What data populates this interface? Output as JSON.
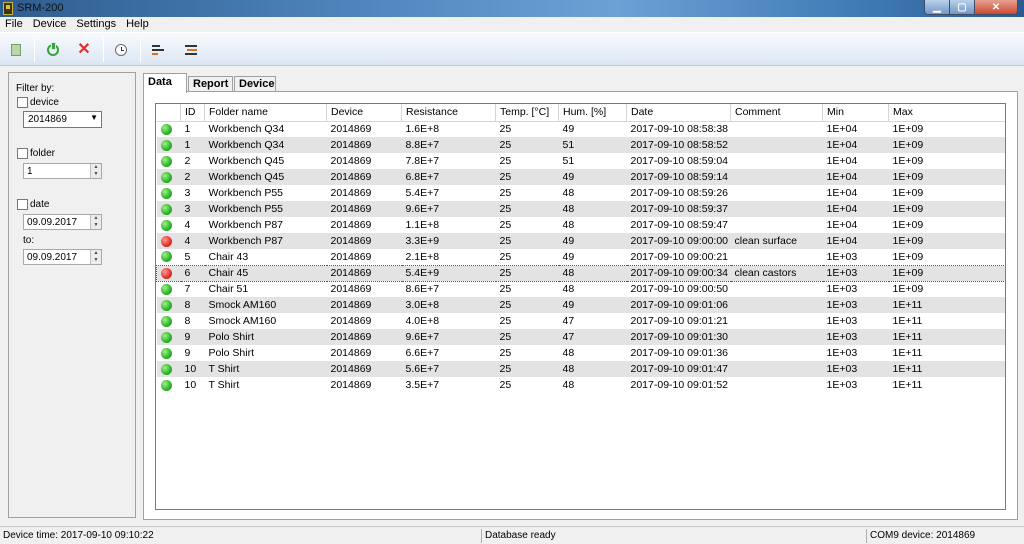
{
  "window": {
    "title": "SRM-200"
  },
  "menu": [
    "File",
    "Device",
    "Settings",
    "Help"
  ],
  "toolbar": {
    "icons": [
      "save-icon",
      "connect-power-icon",
      "disconnect-x-icon",
      "clock-icon",
      "report-bars-icon",
      "export-bars-icon"
    ],
    "disconnect_glyph": "✕"
  },
  "filter": {
    "heading": "Filter by:",
    "device_label": "device",
    "device_value": "2014869",
    "folder_label": "folder",
    "folder_value": "1",
    "date_label": "date",
    "date_from": "09.09.2017",
    "to_label": "to:",
    "date_to": "09.09.2017"
  },
  "tabs": [
    "Data",
    "Report",
    "Device"
  ],
  "table": {
    "columns": [
      "",
      "ID",
      "Folder name",
      "Device",
      "Resistance",
      "Temp. [°C]",
      "Hum. [%]",
      "Date",
      "Comment",
      "Min",
      "Max"
    ],
    "rows": [
      {
        "status": "green",
        "id": "1",
        "folder": "Workbench Q34",
        "device": "2014869",
        "resistance": "1.6E+8",
        "temp": "25",
        "hum": "49",
        "date": "2017-09-10 08:58:38",
        "comment": "",
        "min": "1E+04",
        "max": "1E+09"
      },
      {
        "status": "green",
        "id": "1",
        "folder": "Workbench Q34",
        "device": "2014869",
        "resistance": "8.8E+7",
        "temp": "25",
        "hum": "51",
        "date": "2017-09-10 08:58:52",
        "comment": "",
        "min": "1E+04",
        "max": "1E+09"
      },
      {
        "status": "green",
        "id": "2",
        "folder": "Workbench Q45",
        "device": "2014869",
        "resistance": "7.8E+7",
        "temp": "25",
        "hum": "51",
        "date": "2017-09-10 08:59:04",
        "comment": "",
        "min": "1E+04",
        "max": "1E+09"
      },
      {
        "status": "green",
        "id": "2",
        "folder": "Workbench Q45",
        "device": "2014869",
        "resistance": "6.8E+7",
        "temp": "25",
        "hum": "49",
        "date": "2017-09-10 08:59:14",
        "comment": "",
        "min": "1E+04",
        "max": "1E+09"
      },
      {
        "status": "green",
        "id": "3",
        "folder": "Workbench P55",
        "device": "2014869",
        "resistance": "5.4E+7",
        "temp": "25",
        "hum": "48",
        "date": "2017-09-10 08:59:26",
        "comment": "",
        "min": "1E+04",
        "max": "1E+09"
      },
      {
        "status": "green",
        "id": "3",
        "folder": "Workbench P55",
        "device": "2014869",
        "resistance": "9.6E+7",
        "temp": "25",
        "hum": "48",
        "date": "2017-09-10 08:59:37",
        "comment": "",
        "min": "1E+04",
        "max": "1E+09"
      },
      {
        "status": "green",
        "id": "4",
        "folder": "Workbench P87",
        "device": "2014869",
        "resistance": "1.1E+8",
        "temp": "25",
        "hum": "48",
        "date": "2017-09-10 08:59:47",
        "comment": "",
        "min": "1E+04",
        "max": "1E+09"
      },
      {
        "status": "red",
        "id": "4",
        "folder": "Workbench P87",
        "device": "2014869",
        "resistance": "3.3E+9",
        "temp": "25",
        "hum": "49",
        "date": "2017-09-10 09:00:00",
        "comment": "clean surface",
        "min": "1E+04",
        "max": "1E+09"
      },
      {
        "status": "green",
        "id": "5",
        "folder": "Chair 43",
        "device": "2014869",
        "resistance": "2.1E+8",
        "temp": "25",
        "hum": "49",
        "date": "2017-09-10 09:00:21",
        "comment": "",
        "min": "1E+03",
        "max": "1E+09"
      },
      {
        "status": "red",
        "id": "6",
        "folder": "Chair 45",
        "device": "2014869",
        "resistance": "5.4E+9",
        "temp": "25",
        "hum": "48",
        "date": "2017-09-10 09:00:34",
        "comment": "clean castors",
        "min": "1E+03",
        "max": "1E+09"
      },
      {
        "status": "green",
        "id": "7",
        "folder": "Chair 51",
        "device": "2014869",
        "resistance": "8.6E+7",
        "temp": "25",
        "hum": "48",
        "date": "2017-09-10 09:00:50",
        "comment": "",
        "min": "1E+03",
        "max": "1E+09"
      },
      {
        "status": "green",
        "id": "8",
        "folder": "Smock AM160",
        "device": "2014869",
        "resistance": "3.0E+8",
        "temp": "25",
        "hum": "49",
        "date": "2017-09-10 09:01:06",
        "comment": "",
        "min": "1E+03",
        "max": "1E+11"
      },
      {
        "status": "green",
        "id": "8",
        "folder": "Smock AM160",
        "device": "2014869",
        "resistance": "4.0E+8",
        "temp": "25",
        "hum": "47",
        "date": "2017-09-10 09:01:21",
        "comment": "",
        "min": "1E+03",
        "max": "1E+11"
      },
      {
        "status": "green",
        "id": "9",
        "folder": "Polo Shirt",
        "device": "2014869",
        "resistance": "9.6E+7",
        "temp": "25",
        "hum": "47",
        "date": "2017-09-10 09:01:30",
        "comment": "",
        "min": "1E+03",
        "max": "1E+11"
      },
      {
        "status": "green",
        "id": "9",
        "folder": "Polo Shirt",
        "device": "2014869",
        "resistance": "6.6E+7",
        "temp": "25",
        "hum": "48",
        "date": "2017-09-10 09:01:36",
        "comment": "",
        "min": "1E+03",
        "max": "1E+11"
      },
      {
        "status": "green",
        "id": "10",
        "folder": "T Shirt",
        "device": "2014869",
        "resistance": "5.6E+7",
        "temp": "25",
        "hum": "48",
        "date": "2017-09-10 09:01:47",
        "comment": "",
        "min": "1E+03",
        "max": "1E+11"
      },
      {
        "status": "green",
        "id": "10",
        "folder": "T Shirt",
        "device": "2014869",
        "resistance": "3.5E+7",
        "temp": "25",
        "hum": "48",
        "date": "2017-09-10 09:01:52",
        "comment": "",
        "min": "1E+03",
        "max": "1E+11"
      }
    ],
    "selected_row": 9
  },
  "status": {
    "device_time": "Device time: 2017-09-10 09:10:22",
    "database": "Database ready",
    "com": "COM9 device: 2014869"
  },
  "colors": {
    "ok": "#2cb12c",
    "fail": "#e0302a",
    "row_alt": "#e3e3e3"
  }
}
